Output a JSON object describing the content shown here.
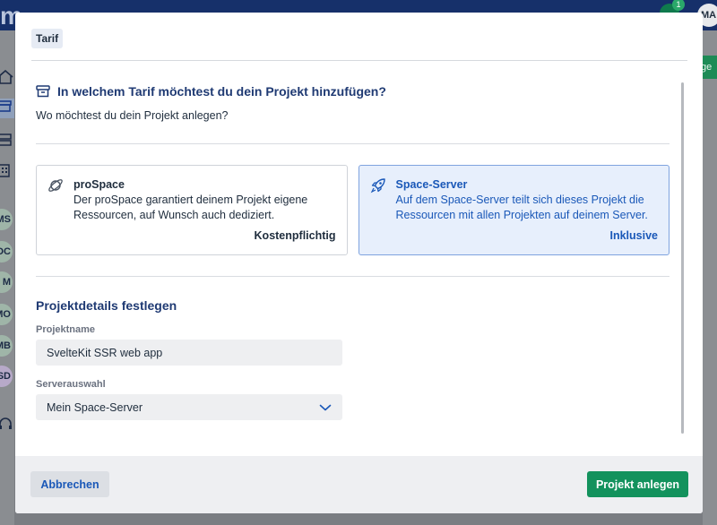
{
  "background": {
    "logo": "m",
    "notification_count": "1",
    "user_initials": "MA",
    "right_button_label": "ge",
    "sidebar_avatars": [
      "MS",
      "DC",
      "M",
      "MO",
      "MB",
      "SD"
    ]
  },
  "modal": {
    "tag": "Tarif",
    "question": {
      "icon": "archive-box-icon",
      "title": "In welchem Tarif möchtest du dein Projekt hinzufügen?",
      "subtitle": "Wo möchtest du dein Projekt anlegen?"
    },
    "plans": [
      {
        "icon": "planet-icon",
        "title": "proSpace",
        "description": "Der proSpace garantiert deinem Projekt eigene Ressourcen, auf Wunsch auch dediziert.",
        "price": "Kostenpflichtig",
        "selected": false
      },
      {
        "icon": "rocket-icon",
        "title": "Space-Server",
        "description": "Auf dem Space-Server teilt sich dieses Projekt die Ressourcen mit allen Projekten auf deinem Server.",
        "price": "Inklusive",
        "selected": true
      }
    ],
    "details": {
      "title": "Projektdetails festlegen",
      "name_label": "Projektname",
      "name_value": "SvelteKit SSR web app",
      "server_label": "Serverauswahl",
      "server_value": "Mein Space-Server"
    },
    "footer": {
      "cancel_label": "Abbrechen",
      "create_label": "Projekt anlegen"
    }
  },
  "colors": {
    "primary_blue": "#1a58b8",
    "heading_blue": "#1f3a73",
    "success_green": "#13925d",
    "selected_bg": "#e7effc"
  }
}
